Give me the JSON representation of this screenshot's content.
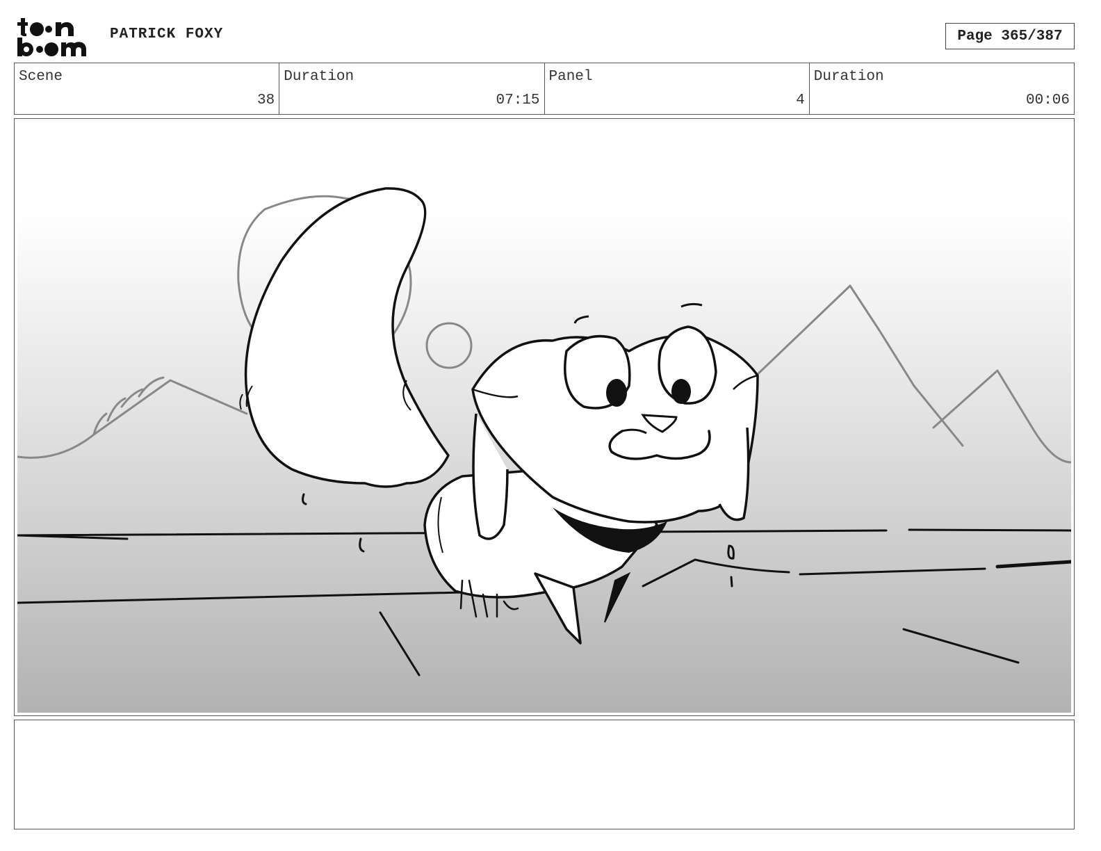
{
  "header": {
    "logo": {
      "line1": "toon",
      "line2": "boom"
    },
    "project_title": "PATRICK FOXY",
    "page_label": "Page 365/387"
  },
  "info": {
    "scene_label": "Scene",
    "scene_value": "38",
    "scene_duration_label": "Duration",
    "scene_duration_value": "07:15",
    "panel_label": "Panel",
    "panel_value": "4",
    "panel_duration_label": "Duration",
    "panel_duration_value": "00:06"
  },
  "panel": {
    "image_description_icon": "fox-sketch-illustration"
  },
  "notes": {
    "text": ""
  }
}
